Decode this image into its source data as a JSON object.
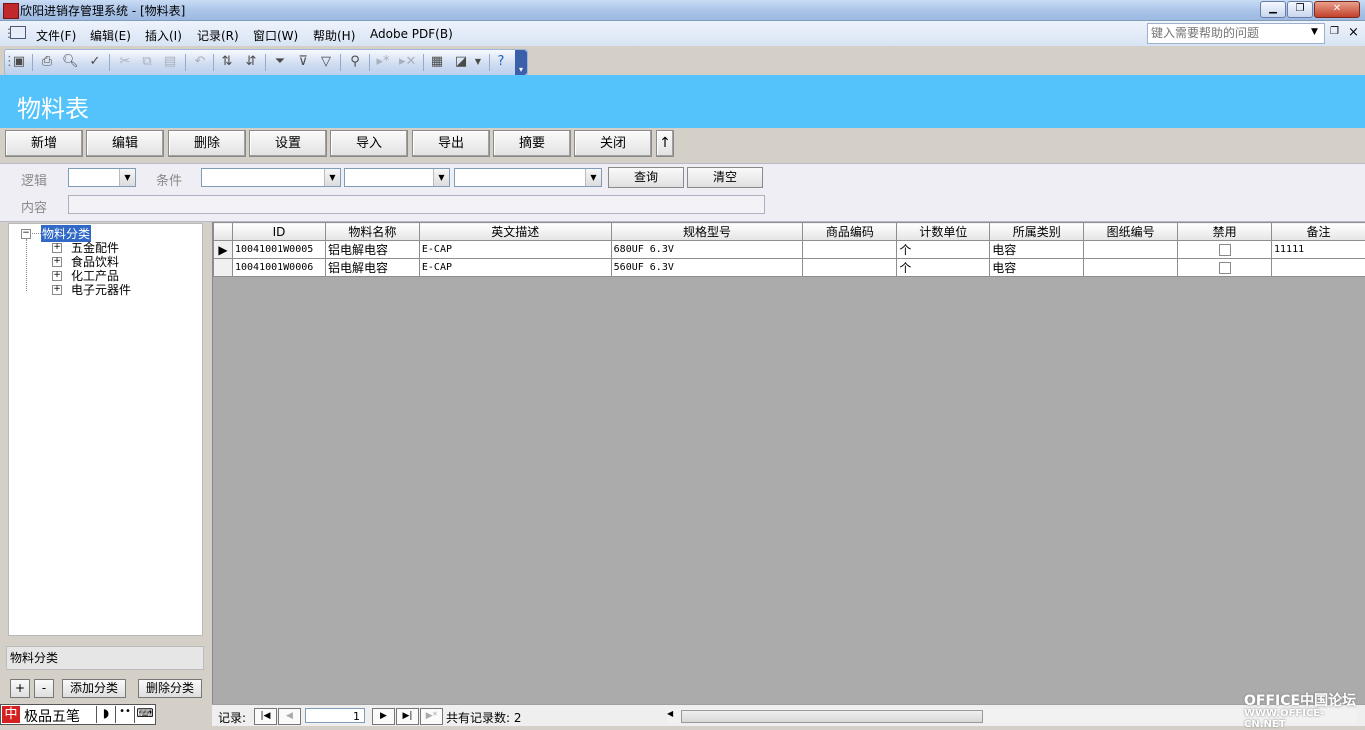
{
  "window": {
    "title": "欣阳进销存管理系统 - [物料表]"
  },
  "menu": [
    "文件(F)",
    "编辑(E)",
    "插入(I)",
    "记录(R)",
    "窗口(W)",
    "帮助(H)",
    "Adobe PDF(B)"
  ],
  "help_box": {
    "placeholder": "键入需要帮助的问题"
  },
  "form": {
    "title": "物料表"
  },
  "commands": [
    "新增",
    "编辑",
    "删除",
    "设置",
    "导入",
    "导出",
    "摘要",
    "关闭",
    "↑"
  ],
  "filter": {
    "logic_label": "逻辑",
    "condition_label": "条件",
    "content_label": "内容",
    "query_button": "查询",
    "clear_button": "清空"
  },
  "tree": {
    "root": "物料分类",
    "children": [
      "五金配件",
      "食品饮料",
      "化工产品",
      "电子元器件"
    ]
  },
  "category_label": "物料分类",
  "tree_buttons": {
    "plus": "+",
    "minus": "-",
    "add": "添加分类",
    "delete": "删除分类"
  },
  "grid": {
    "columns": [
      "ID",
      "物料名称",
      "英文描述",
      "规格型号",
      "商品编码",
      "计数单位",
      "所属类别",
      "图纸编号",
      "禁用",
      "备注"
    ],
    "rows": [
      {
        "id": "10041001W0005",
        "name": "铝电解电容",
        "en": "E-CAP",
        "spec": "680UF 6.3V",
        "code": "",
        "unit": "个",
        "category": "电容",
        "drawing": "",
        "disabled": false,
        "note": "11111",
        "current": true
      },
      {
        "id": "10041001W0006",
        "name": "铝电解电容",
        "en": "E-CAP",
        "spec": "560UF 6.3V",
        "code": "",
        "unit": "个",
        "category": "电容",
        "drawing": "",
        "disabled": false,
        "note": "",
        "current": false
      }
    ]
  },
  "status": {
    "record_label": "记录:",
    "current_record": "1",
    "total": "共有记录数: 2"
  },
  "ime": {
    "label": "极品五笔"
  },
  "watermark": {
    "line1": "OFFICE中国论坛",
    "line2": "WWW.OFFICE-CN.NET"
  },
  "colors": {
    "header_bg": "#55c3fb",
    "grid_bg": "#ababab"
  }
}
